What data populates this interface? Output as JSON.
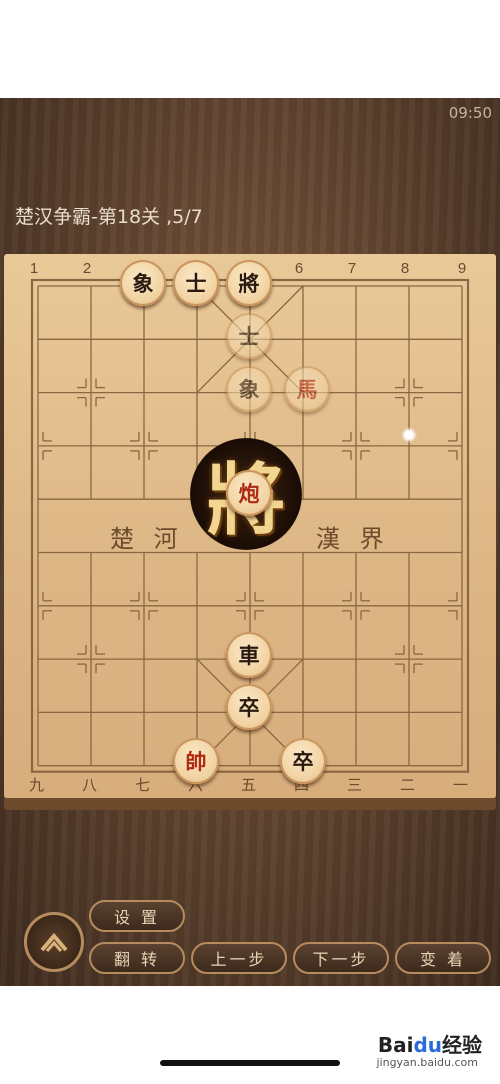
{
  "status": {
    "time": "09:50"
  },
  "level": {
    "title": "楚汉争霸-第18关  ,5/7"
  },
  "board": {
    "top_numbers": [
      "1",
      "2",
      "3",
      "4",
      "5",
      "6",
      "7",
      "8",
      "9"
    ],
    "bottom_numbers": [
      "九",
      "八",
      "七",
      "六",
      "五",
      "四",
      "三",
      "二",
      "一"
    ],
    "river_left": "楚 河",
    "river_right": "漢 界"
  },
  "pieces": [
    {
      "id": "black-elephant",
      "label": "象",
      "side": "black",
      "file": 2,
      "rank": 0
    },
    {
      "id": "black-advisor",
      "label": "士",
      "side": "black",
      "file": 3,
      "rank": 0
    },
    {
      "id": "black-general",
      "label": "將",
      "side": "black",
      "file": 4,
      "rank": 0
    },
    {
      "id": "black-advisor-2",
      "label": "士",
      "side": "black",
      "file": 4,
      "rank": 1
    },
    {
      "id": "black-elephant-2",
      "label": "象",
      "side": "black",
      "file": 4,
      "rank": 2
    },
    {
      "id": "red-horse",
      "label": "馬",
      "side": "red",
      "file": 5,
      "rank": 2
    },
    {
      "id": "red-cannon",
      "label": "炮",
      "side": "red",
      "file": 4,
      "rank": 4
    },
    {
      "id": "red-chariot",
      "label": "車",
      "side": "black",
      "file": 4,
      "rank": 7
    },
    {
      "id": "black-soldier-1",
      "label": "卒",
      "side": "black",
      "file": 4,
      "rank": 8
    },
    {
      "id": "red-king",
      "label": "帥",
      "side": "red",
      "file": 3,
      "rank": 9
    },
    {
      "id": "black-soldier-2",
      "label": "卒",
      "side": "black",
      "file": 5,
      "rank": 9
    }
  ],
  "check_banner": "將",
  "controls": {
    "settings": "设 置",
    "flip": "翻 转",
    "prev": "上一步",
    "next": "下一步",
    "change": "变 着"
  },
  "watermark": {
    "brand_a": "Bai",
    "brand_b": "du",
    "brand_c": "经验",
    "url": "jingyan.baidu.com"
  }
}
